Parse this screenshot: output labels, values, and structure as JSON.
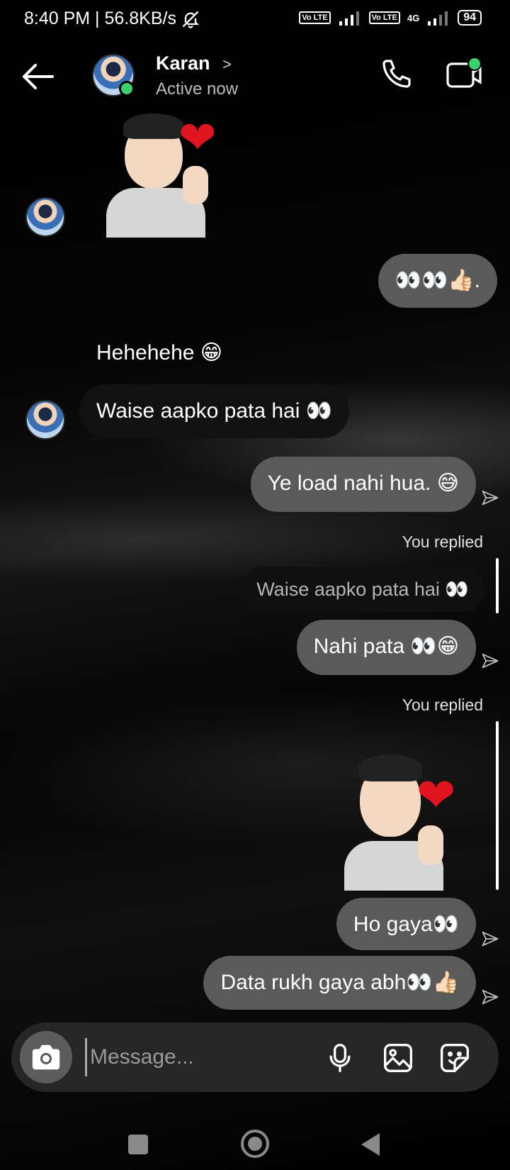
{
  "status_bar": {
    "time_speed": "8:40 PM | 56.8KB/s",
    "lte1": "Vo LTE",
    "lte2": "Vo LTE",
    "network": "4G",
    "battery": "94"
  },
  "header": {
    "contact_name": "Karan",
    "contact_status": "Active now"
  },
  "messages": {
    "m1": "👀👀👍🏻.",
    "m2": "Hehehehe 😁",
    "m3": "Waise aapko pata hai 👀",
    "m4": "Ye load nahi hua. 😅",
    "replied1": "You replied",
    "quote1": "Waise aapko pata hai 👀",
    "m5": "Nahi pata 👀😁",
    "replied2": "You replied",
    "m6": "Ho gaya👀",
    "m7": "Data rukh gaya abh👀👍🏻"
  },
  "composer": {
    "placeholder": "Message..."
  },
  "colors": {
    "accent_online": "#3bd16f",
    "outgoing_bubble": "#5a5a5a",
    "heart": "#e0141e"
  }
}
